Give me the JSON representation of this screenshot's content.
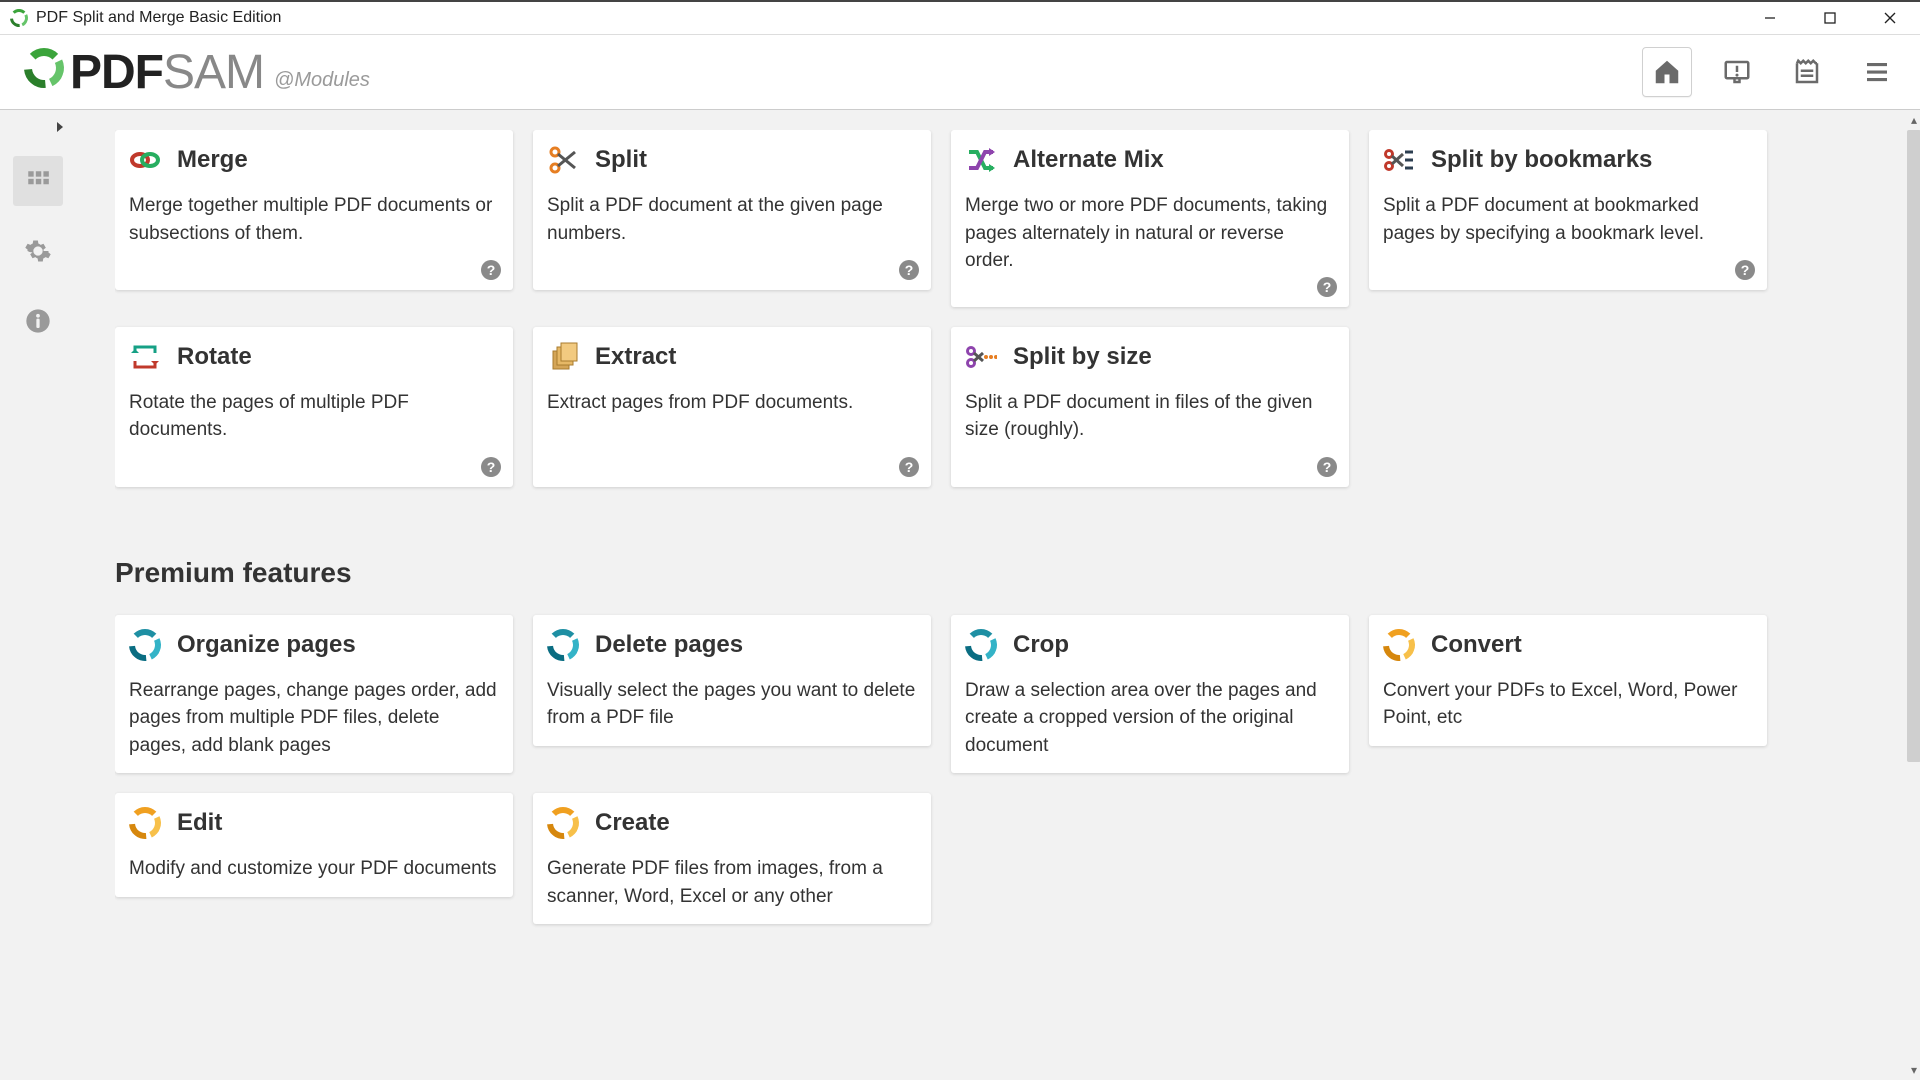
{
  "window": {
    "title": "PDF Split and Merge Basic Edition"
  },
  "toolbar": {
    "brand_prefix": "PDF",
    "brand_suffix": "SAM",
    "location": "@Modules"
  },
  "modules": [
    {
      "key": "merge",
      "title": "Merge",
      "desc": "Merge together multiple PDF documents or subsections of them."
    },
    {
      "key": "split",
      "title": "Split",
      "desc": "Split a PDF document at the given page numbers."
    },
    {
      "key": "altmix",
      "title": "Alternate Mix",
      "desc": "Merge two or more PDF documents, taking pages alternately in natural or reverse order."
    },
    {
      "key": "splitbk",
      "title": "Split by bookmarks",
      "desc": "Split a PDF document at bookmarked pages by specifying a bookmark level."
    },
    {
      "key": "rotate",
      "title": "Rotate",
      "desc": "Rotate the pages of multiple PDF documents."
    },
    {
      "key": "extract",
      "title": "Extract",
      "desc": "Extract pages from PDF documents."
    },
    {
      "key": "splitsize",
      "title": "Split by size",
      "desc": "Split a PDF document in files of the given size (roughly)."
    }
  ],
  "premium_heading": "Premium features",
  "premium": [
    {
      "key": "organize",
      "title": "Organize pages",
      "desc": "Rearrange pages, change pages order, add pages from multiple PDF files, delete pages, add blank pages",
      "icon": "teal"
    },
    {
      "key": "delete",
      "title": "Delete pages",
      "desc": "Visually select the pages you want to delete from a PDF file",
      "icon": "teal"
    },
    {
      "key": "crop",
      "title": "Crop",
      "desc": "Draw a selection area over the pages and create a cropped version of the original document",
      "icon": "teal"
    },
    {
      "key": "convert",
      "title": "Convert",
      "desc": "Convert your PDFs to Excel, Word, Power Point, etc",
      "icon": "orange"
    },
    {
      "key": "edit",
      "title": "Edit",
      "desc": "Modify and customize your PDF documents",
      "icon": "orange"
    },
    {
      "key": "create",
      "title": "Create",
      "desc": "Generate PDF files from images, from a scanner, Word, Excel or any other",
      "icon": "orange"
    }
  ]
}
